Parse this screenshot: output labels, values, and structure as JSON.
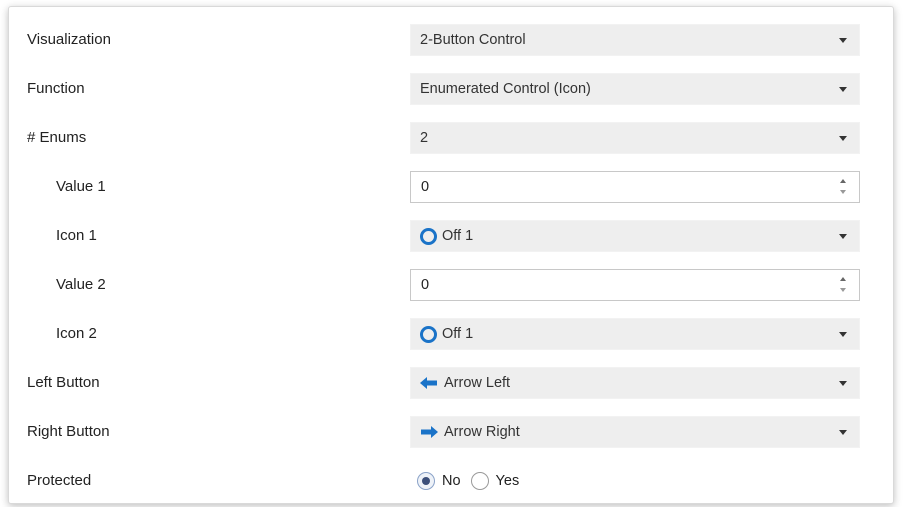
{
  "rows": {
    "visualization": {
      "label": "Visualization",
      "value": "2-Button Control"
    },
    "function": {
      "label": "Function",
      "value": "Enumerated Control (Icon)"
    },
    "enums": {
      "label": "# Enums",
      "value": "2"
    },
    "value1": {
      "label": "Value 1",
      "value": "0"
    },
    "icon1": {
      "label": "Icon 1",
      "value": "Off 1",
      "icon": "ring-icon"
    },
    "value2": {
      "label": "Value 2",
      "value": "0"
    },
    "icon2": {
      "label": "Icon 2",
      "value": "Off 1",
      "icon": "ring-icon"
    },
    "left_button": {
      "label": "Left Button",
      "value": "Arrow Left",
      "icon": "arrow-left-icon"
    },
    "right_button": {
      "label": "Right Button",
      "value": "Arrow Right",
      "icon": "arrow-right-icon"
    },
    "protected": {
      "label": "Protected",
      "options": [
        "No",
        "Yes"
      ],
      "selected": "No"
    }
  },
  "colors": {
    "icon_blue": "#1a73c8",
    "select_bg": "#eeeeee"
  }
}
